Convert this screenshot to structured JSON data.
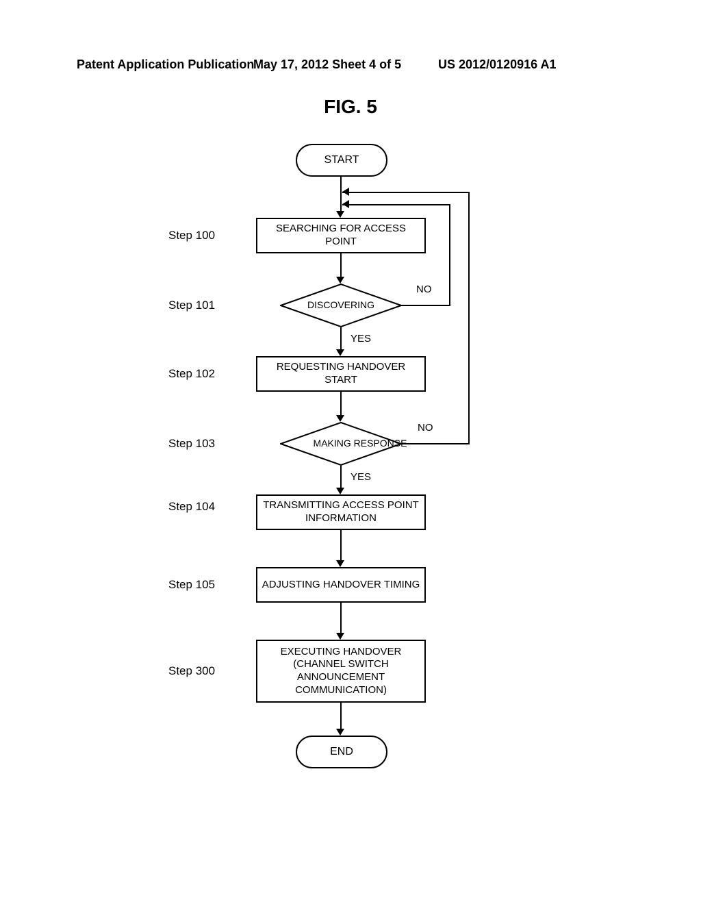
{
  "header": {
    "left": "Patent Application Publication",
    "center": "May 17, 2012  Sheet 4 of 5",
    "right": "US 2012/0120916 A1"
  },
  "figure_title": "FIG. 5",
  "nodes": {
    "start": "START",
    "end": "END",
    "step100": {
      "label": "Step 100",
      "text": "SEARCHING FOR ACCESS POINT"
    },
    "step101": {
      "label": "Step 101",
      "text": "DISCOVERING",
      "yes": "YES",
      "no": "NO"
    },
    "step102": {
      "label": "Step 102",
      "text": "REQUESTING HANDOVER START"
    },
    "step103": {
      "label": "Step 103",
      "text": "MAKING RESPONSE",
      "yes": "YES",
      "no": "NO"
    },
    "step104": {
      "label": "Step 104",
      "text": "TRANSMITTING ACCESS POINT INFORMATION"
    },
    "step105": {
      "label": "Step 105",
      "text": "ADJUSTING HANDOVER TIMING"
    },
    "step300": {
      "label": "Step 300",
      "text": "EXECUTING HANDOVER (CHANNEL SWITCH ANNOUNCEMENT COMMUNICATION)"
    }
  },
  "chart_data": {
    "type": "flowchart",
    "nodes": [
      {
        "id": "start",
        "type": "terminator",
        "text": "START"
      },
      {
        "id": "s100",
        "type": "process",
        "label": "Step 100",
        "text": "SEARCHING FOR ACCESS POINT"
      },
      {
        "id": "s101",
        "type": "decision",
        "label": "Step 101",
        "text": "DISCOVERING"
      },
      {
        "id": "s102",
        "type": "process",
        "label": "Step 102",
        "text": "REQUESTING HANDOVER START"
      },
      {
        "id": "s103",
        "type": "decision",
        "label": "Step 103",
        "text": "MAKING RESPONSE"
      },
      {
        "id": "s104",
        "type": "process",
        "label": "Step 104",
        "text": "TRANSMITTING ACCESS POINT INFORMATION"
      },
      {
        "id": "s105",
        "type": "process",
        "label": "Step 105",
        "text": "ADJUSTING HANDOVER TIMING"
      },
      {
        "id": "s300",
        "type": "process",
        "label": "Step 300",
        "text": "EXECUTING HANDOVER (CHANNEL SWITCH ANNOUNCEMENT COMMUNICATION)"
      },
      {
        "id": "end",
        "type": "terminator",
        "text": "END"
      }
    ],
    "edges": [
      {
        "from": "start",
        "to": "s100"
      },
      {
        "from": "s100",
        "to": "s101"
      },
      {
        "from": "s101",
        "to": "s102",
        "label": "YES"
      },
      {
        "from": "s101",
        "to": "s100",
        "label": "NO"
      },
      {
        "from": "s102",
        "to": "s103"
      },
      {
        "from": "s103",
        "to": "s104",
        "label": "YES"
      },
      {
        "from": "s103",
        "to": "s100",
        "label": "NO"
      },
      {
        "from": "s104",
        "to": "s105"
      },
      {
        "from": "s105",
        "to": "s300"
      },
      {
        "from": "s300",
        "to": "end"
      }
    ]
  }
}
